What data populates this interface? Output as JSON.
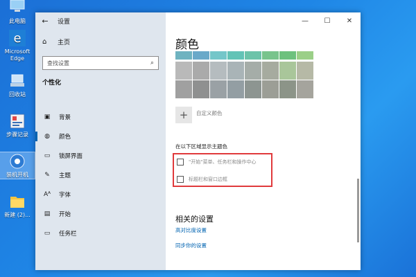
{
  "desktop": {
    "icons": [
      {
        "label": "此电脑",
        "name": "this-pc-desktop-icon"
      },
      {
        "label": "Microsoft Edge",
        "name": "edge-desktop-icon"
      },
      {
        "label": "回收站",
        "name": "recycle-bin-desktop-icon"
      },
      {
        "label": "步骤记录",
        "name": "steps-recorder-desktop-icon"
      },
      {
        "label": "装机开机",
        "name": "app-desktop-icon"
      },
      {
        "label": "新建 (2)...",
        "name": "folder-desktop-icon"
      }
    ]
  },
  "window": {
    "title": "设置",
    "back_icon": "←",
    "controls": {
      "minimize": "—",
      "maximize": "☐",
      "close": "✕"
    }
  },
  "sidebar": {
    "home_label": "主页",
    "search_placeholder": "查找设置",
    "section_title": "个性化",
    "items": [
      {
        "label": "背景",
        "icon": "background-icon",
        "glyph": "▣",
        "active": false
      },
      {
        "label": "颜色",
        "icon": "palette-icon",
        "glyph": "◍",
        "active": true
      },
      {
        "label": "锁屏界面",
        "icon": "lock-screen-icon",
        "glyph": "▭",
        "active": false
      },
      {
        "label": "主题",
        "icon": "themes-icon",
        "glyph": "✎",
        "active": false
      },
      {
        "label": "字体",
        "icon": "fonts-icon",
        "glyph": "Aᴬ",
        "active": false
      },
      {
        "label": "开始",
        "icon": "start-icon",
        "glyph": "▤",
        "active": false
      },
      {
        "label": "任务栏",
        "icon": "taskbar-icon",
        "glyph": "▭",
        "active": false
      }
    ]
  },
  "main": {
    "heading": "颜色",
    "swatch_rows": [
      [
        "#6fb3c0",
        "#6aa9c9",
        "#74c6c9",
        "#63c3b6",
        "#6cc3a9",
        "#78c48c",
        "#6dc17d",
        "#9bcf88"
      ],
      [
        "#b9b9b9",
        "#aaaaaa",
        "#b5bcbf",
        "#a9b4b7",
        "#a5ada8",
        "#a6ab9f",
        "#a9c69a",
        "#b6b9a6"
      ],
      [
        "#a0a0a0",
        "#8f9090",
        "#9aa1a5",
        "#939ea3",
        "#8d9591",
        "#9c9e96",
        "#8c9488",
        "#a5a49d"
      ]
    ],
    "custom_color_label": "自定义颜色",
    "show_accent_heading": "在以下区域显示主题色",
    "checkbox_start": "\"开始\"菜单、任务栏和操作中心",
    "checkbox_titlebar": "标题栏和窗口边框",
    "related_heading": "相关的设置",
    "link_contrast": "高对比度设置",
    "link_sync": "同步你的设置"
  },
  "colors": {
    "accent": "#0063b1",
    "highlight_box": "#e0393b",
    "sidebar_bg": "#dfe6ee"
  }
}
